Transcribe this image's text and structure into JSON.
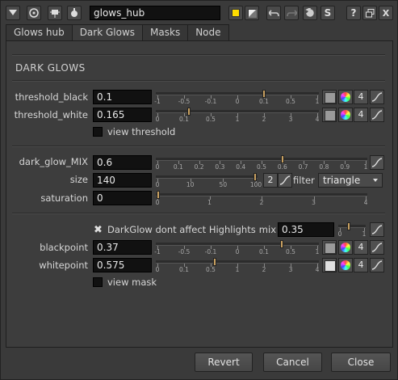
{
  "toolbar": {
    "node_name": "glows_hub",
    "icons": [
      "collapse-arrow-icon",
      "center-target-icon",
      "pin-icon",
      "settings-gear-icon",
      "color-yellow-icon",
      "diagonal-toggle-icon",
      "undo-icon",
      "redo-icon",
      "revert-icon",
      "script-s-icon",
      "help-icon",
      "float-window-icon",
      "close-icon"
    ],
    "help_label": "?",
    "script_label": "S",
    "close_label": "X"
  },
  "tabs": [
    {
      "label": "Glows hub",
      "active": false
    },
    {
      "label": "Dark Glows",
      "active": true
    },
    {
      "label": "Masks",
      "active": false
    },
    {
      "label": "Node",
      "active": false
    }
  ],
  "section": {
    "title": "DARK GLOWS"
  },
  "threshold_black": {
    "label": "threshold_black",
    "value": "0.1",
    "slider_value": 0.1,
    "ticks": [
      "-1",
      "-0.5",
      "-0.1",
      "0",
      "0.1",
      "0.5",
      "1"
    ],
    "channels": "4"
  },
  "threshold_white": {
    "label": "threshold_white",
    "value": "0.165",
    "slider_value": 0.165,
    "ticks": [
      "0",
      "0.1",
      "0.5",
      "1",
      "2",
      "3",
      "4"
    ],
    "channels": "4"
  },
  "view_threshold": {
    "label": "view threshold",
    "checked": false
  },
  "dark_glow_mix": {
    "label": "dark_glow_MIX",
    "value": "0.6",
    "slider_value": 0.6,
    "ticks": [
      "0",
      "0.1",
      "0.2",
      "0.3",
      "0.4",
      "0.5",
      "0.6",
      "0.7",
      "0.8",
      "0.9",
      "1"
    ]
  },
  "size": {
    "label": "size",
    "value": "140",
    "slider_value": 140,
    "ticks": [
      "0",
      "10",
      "50",
      "100"
    ],
    "channels": "2",
    "filter_label": "filter",
    "filter_value": "triangle"
  },
  "saturation": {
    "label": "saturation",
    "value": "0",
    "slider_value": 0,
    "ticks": [
      "0",
      "1",
      "2",
      "3",
      "4"
    ]
  },
  "dont_affect_highlights": {
    "label": "DarkGlow dont affect Highlights",
    "checked": true,
    "mix_label": "mix",
    "mix_value": "0.35",
    "mix_slider_value": 0.35,
    "mix_ticks": [
      "0",
      "1"
    ]
  },
  "blackpoint": {
    "label": "blackpoint",
    "value": "0.37",
    "slider_value": 0.37,
    "ticks": [
      "-1",
      "-0.5",
      "-0.1",
      "0",
      "0.1",
      "0.5",
      "1"
    ],
    "channels": "4"
  },
  "whitepoint": {
    "label": "whitepoint",
    "value": "0.575",
    "slider_value": 0.575,
    "ticks": [
      "0",
      "0.1",
      "0.5",
      "1",
      "2",
      "3",
      "4"
    ],
    "channels": "4"
  },
  "view_mask": {
    "label": "view mask",
    "checked": false
  },
  "buttons": {
    "revert": "Revert",
    "cancel": "Cancel",
    "close": "Close"
  },
  "colors": {
    "handle": "#c8a060",
    "field_bg": "#111111",
    "panel_bg": "#3d3d3d"
  }
}
